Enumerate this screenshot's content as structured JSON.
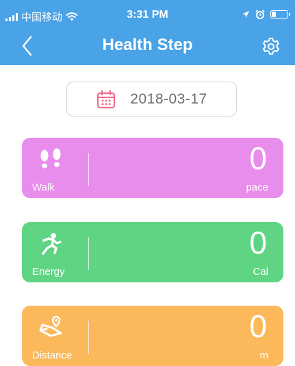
{
  "status_bar": {
    "carrier": "中国移动",
    "time": "3:31 PM",
    "battery_level": 0.25
  },
  "nav": {
    "title": "Health Step",
    "back_icon": "chevron-left-icon",
    "settings_icon": "gear-icon"
  },
  "date": {
    "value": "2018-03-17",
    "icon": "calendar-icon"
  },
  "cards": {
    "walk": {
      "label": "Walk",
      "value": "0",
      "unit": "pace",
      "icon": "footprints-icon",
      "color": "#e98ded"
    },
    "energy": {
      "label": "Energy",
      "value": "0",
      "unit": "Cal",
      "icon": "running-man-icon",
      "color": "#5fd584"
    },
    "distance": {
      "label": "Distance",
      "value": "0",
      "unit": "m",
      "icon": "route-icon",
      "color": "#fbb95c"
    }
  },
  "colors": {
    "header": "#4aa3e6",
    "calendar_icon": "#f06b8c"
  }
}
